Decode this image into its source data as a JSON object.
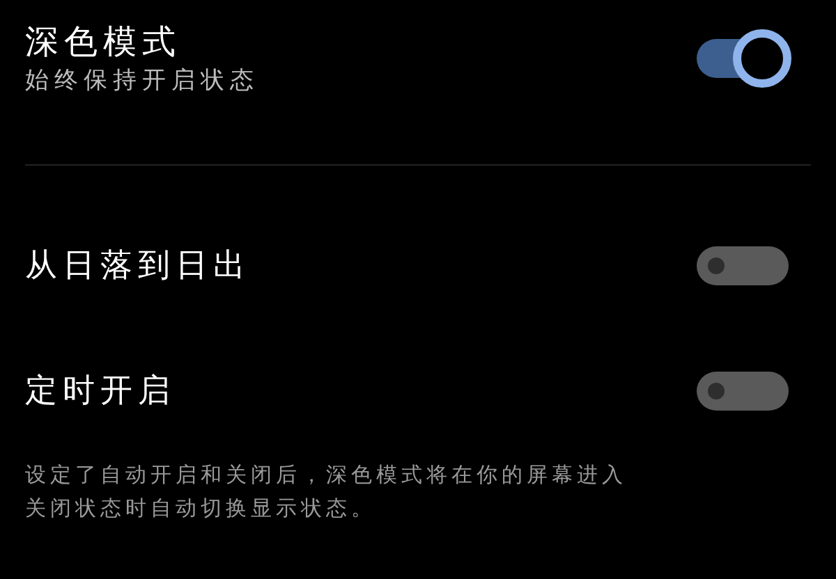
{
  "dark_mode": {
    "title": "深色模式",
    "subtitle": "始终保持开启状态",
    "on": true
  },
  "schedule": [
    {
      "label": "从日落到日出",
      "on": false
    },
    {
      "label": "定时开启",
      "on": false
    }
  ],
  "footer_note": [
    "设定了自动开启和关闭后，深色模式将在你的屏幕进入",
    "关闭状态时自动切换显示状态。"
  ]
}
